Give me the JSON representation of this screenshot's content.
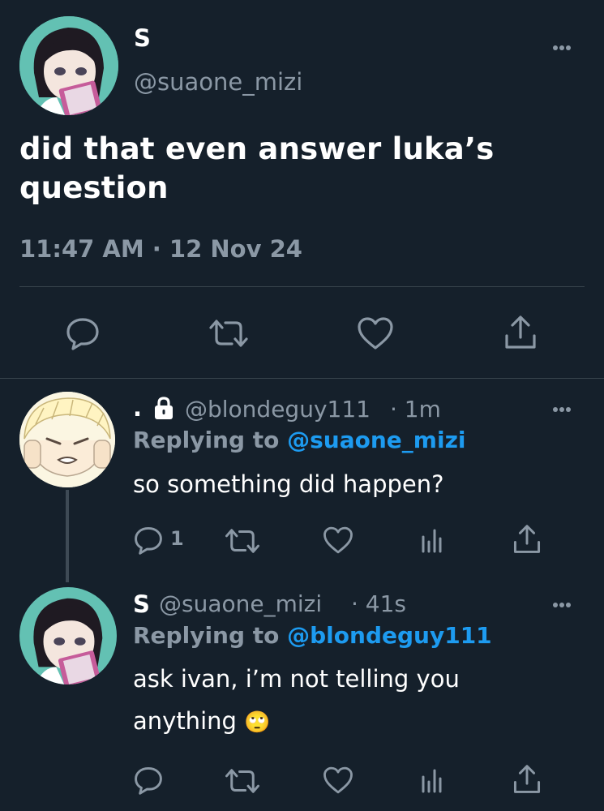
{
  "main_tweet": {
    "display_name": "S",
    "handle": "@suaone_mizi",
    "text_line1": "did that even answer luka’s",
    "text_line2": "question",
    "timestamp": "11:47 AM · 12 Nov 24"
  },
  "reply1": {
    "display_name": ".",
    "handle": "@blondeguy111",
    "age": "· 1m",
    "replying_prefix": "Replying to",
    "replying_to": "@suaone_mizi",
    "text": "so something did happen?",
    "reply_count": "1"
  },
  "reply2": {
    "display_name": "S",
    "handle": "@suaone_mizi",
    "age": "· 41s",
    "replying_prefix": "Replying to",
    "replying_to": "@blondeguy111",
    "text_line1": "ask ivan, i’m not telling you",
    "text_line2": "anything",
    "emoji": "🙄"
  },
  "colors": {
    "background": "#15202b",
    "muted": "#8b98a5",
    "link": "#1d9bf0",
    "divider": "#38444d"
  },
  "icons": [
    "more-icon",
    "reply-icon",
    "retweet-icon",
    "like-icon",
    "share-icon",
    "analytics-icon",
    "lock-icon"
  ]
}
